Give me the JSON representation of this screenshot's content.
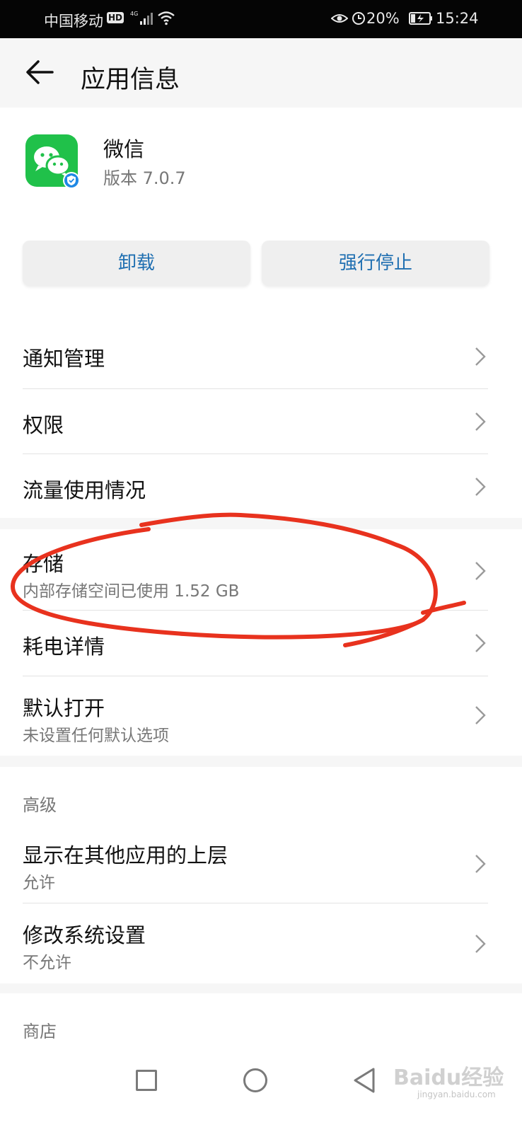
{
  "status_bar": {
    "carrier": "中国移动",
    "hd": "HD",
    "network": "4G",
    "battery": "20%",
    "time": "15:24"
  },
  "header": {
    "title": "应用信息",
    "back_icon": "arrow-left-icon"
  },
  "app": {
    "name": "微信",
    "version": "版本 7.0.7",
    "icon": "wechat-icon",
    "badge": "verified-shield-icon"
  },
  "actions": {
    "uninstall": "卸载",
    "force_stop": "强行停止"
  },
  "menu_group_1": [
    {
      "label": "通知管理"
    },
    {
      "label": "权限"
    },
    {
      "label": "流量使用情况"
    }
  ],
  "menu_group_2": [
    {
      "label": "存储",
      "sub": "内部存储空间已使用 1.52 GB"
    },
    {
      "label": "耗电详情"
    },
    {
      "label": "默认打开",
      "sub": "未设置任何默认选项"
    }
  ],
  "advanced": {
    "title": "高级",
    "items": [
      {
        "label": "显示在其他应用的上层",
        "sub": "允许"
      },
      {
        "label": "修改系统设置",
        "sub": "不允许"
      }
    ]
  },
  "store": {
    "title": "商店"
  },
  "nav": {
    "recent": "square-icon",
    "home": "circle-icon",
    "back": "triangle-back-icon"
  },
  "watermark": {
    "main": "Baidu经验",
    "sub": "jingyan.baidu.com"
  },
  "colors": {
    "accent": "#1f6fb1",
    "annotation": "#e8321e",
    "wechat": "#20c14a"
  }
}
